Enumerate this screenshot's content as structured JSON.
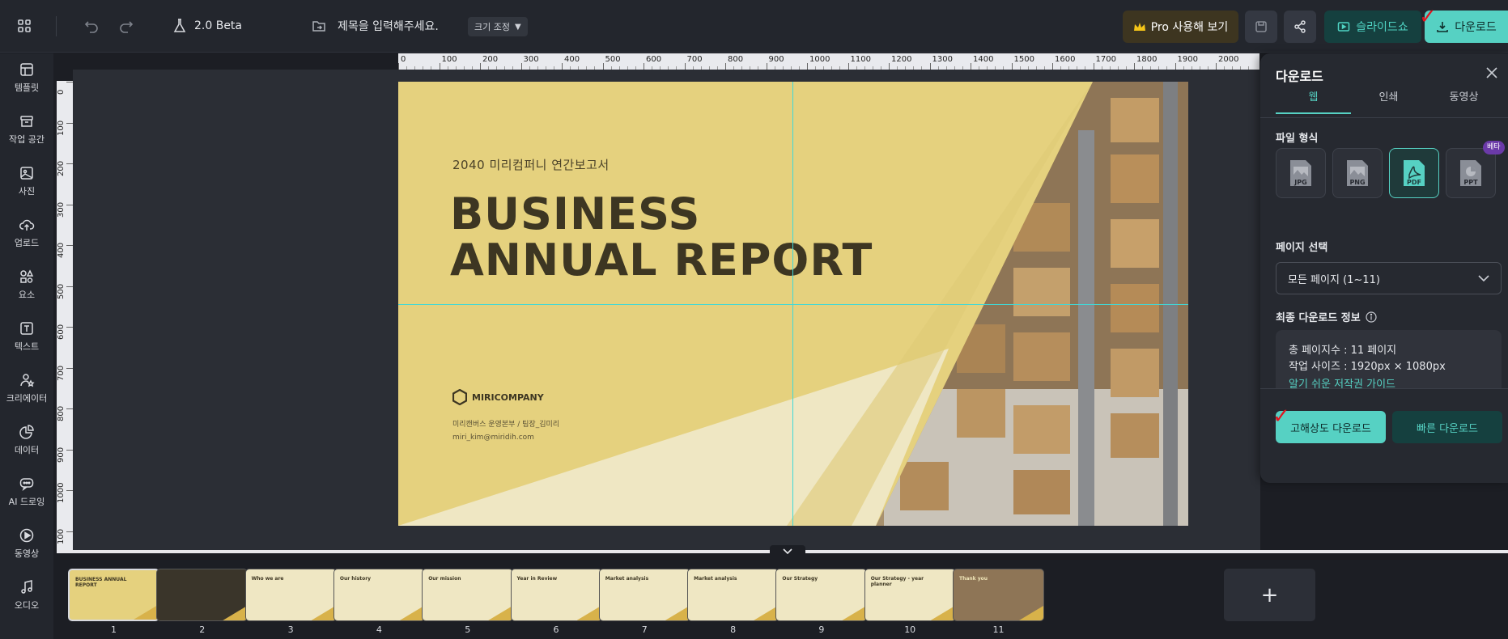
{
  "topbar": {
    "version": "2.0 Beta",
    "title_placeholder": "제목을 입력해주세요.",
    "resize_label": "크기 조정",
    "pro_label": "Pro 사용해 보기",
    "slideshow_label": "슬라이드쇼",
    "download_label": "다운로드"
  },
  "sidebar": {
    "items": [
      {
        "label": "템플릿",
        "icon": "template-icon"
      },
      {
        "label": "작업 공간",
        "icon": "archive-icon"
      },
      {
        "label": "사진",
        "icon": "photo-icon"
      },
      {
        "label": "업로드",
        "icon": "upload-cloud-icon"
      },
      {
        "label": "요소",
        "icon": "shapes-icon"
      },
      {
        "label": "텍스트",
        "icon": "text-icon"
      },
      {
        "label": "크리에이터",
        "icon": "creator-icon"
      },
      {
        "label": "데이터",
        "icon": "chart-icon"
      },
      {
        "label": "AI 드로잉",
        "icon": "ai-chat-icon"
      },
      {
        "label": "동영상",
        "icon": "play-icon"
      },
      {
        "label": "오디오",
        "icon": "music-icon"
      }
    ]
  },
  "ruler": {
    "h_ticks": [
      "0",
      "100",
      "200",
      "300",
      "400",
      "500",
      "600",
      "700",
      "800",
      "900",
      "1000",
      "1100",
      "1200",
      "1300",
      "1400",
      "1500",
      "1600",
      "1700",
      "1800",
      "1900",
      "2000"
    ],
    "v_ticks": [
      "0",
      "100",
      "200",
      "300",
      "400",
      "500",
      "600",
      "700",
      "800",
      "900",
      "1000",
      "100"
    ]
  },
  "slide": {
    "subtitle": "2040 미리컴퍼니 연간보고서",
    "title_line1": "BUSINESS",
    "title_line2": "ANNUAL REPORT",
    "company": "MIRICOMPANY",
    "contact_line1": "미리캔버스 운영본부 / 팀장_김미리",
    "contact_line2": "miri_kim@miridih.com"
  },
  "download_panel": {
    "title": "다운로드",
    "tabs": [
      "웹",
      "인쇄",
      "동영상"
    ],
    "active_tab": "웹",
    "file_format_label": "파일 형식",
    "formats": [
      "JPG",
      "PNG",
      "PDF",
      "PPT"
    ],
    "selected_format": "PDF",
    "beta_badge": "베타",
    "page_select_label": "페이지 선택",
    "page_select_value": "모든 페이지 (1~11)",
    "final_info_label": "최종 다운로드 정보",
    "total_pages": "총 페이지수 : 11 페이지",
    "work_size": "작업 사이즈 : 1920px × 1080px",
    "copyright_link": "알기 쉬운 저작권 가이드",
    "hd_download": "고해상도 다운로드",
    "fast_download": "빠른 다운로드"
  },
  "thumbnails": [
    {
      "num": "1",
      "label": "BUSINESS ANNUAL REPORT"
    },
    {
      "num": "2",
      "label": ""
    },
    {
      "num": "3",
      "label": "Who we are"
    },
    {
      "num": "4",
      "label": "Our history"
    },
    {
      "num": "5",
      "label": "Our mission"
    },
    {
      "num": "6",
      "label": "Year in Review"
    },
    {
      "num": "7",
      "label": "Market analysis"
    },
    {
      "num": "8",
      "label": "Market analysis"
    },
    {
      "num": "9",
      "label": "Our Strategy"
    },
    {
      "num": "10",
      "label": "Our Strategy - year planner"
    },
    {
      "num": "11",
      "label": "Thank you"
    }
  ],
  "add_page": "+",
  "colors": {
    "accent": "#56d1c3",
    "slide_bg": "#e5d17e",
    "slide_text": "#3d3622"
  }
}
